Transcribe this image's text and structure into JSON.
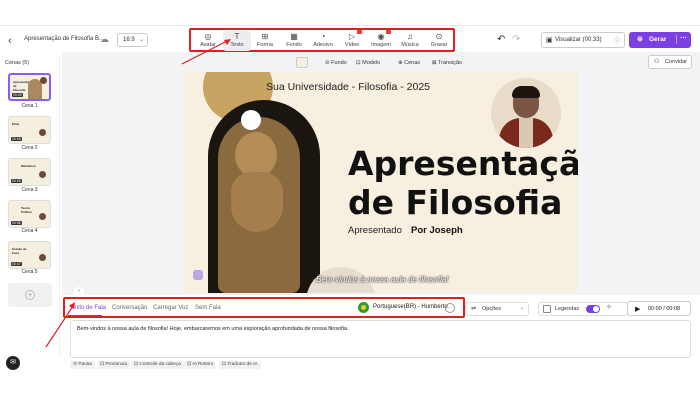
{
  "header": {
    "back_icon": "arrow-left-icon",
    "project_title": "Apresentação de Filosofia B...",
    "cloud_icon": "cloud-icon",
    "aspect_ratio": "16:9",
    "tools": [
      {
        "label": "Avatar",
        "icon": "avatar-icon"
      },
      {
        "label": "Texto",
        "icon": "text-icon",
        "active": true
      },
      {
        "label": "Forma",
        "icon": "shapes-icon"
      },
      {
        "label": "Fundo",
        "icon": "background-icon"
      },
      {
        "label": "Adesivo",
        "icon": "sticker-icon"
      },
      {
        "label": "Vídeo",
        "icon": "video-icon",
        "pro": true
      },
      {
        "label": "Imagem",
        "icon": "image-icon",
        "pro": true
      },
      {
        "label": "Música",
        "icon": "music-icon"
      },
      {
        "label": "Gravar",
        "icon": "record-icon"
      }
    ],
    "preview_label": "Visualizar (00:33)",
    "generate_label": "Gerar",
    "accent": "#7b3fe4"
  },
  "canvas_toolbar": {
    "items": [
      "Fundo",
      "Modelo",
      "Cenas",
      "Transição"
    ]
  },
  "invite_label": "Convidar",
  "scenes": {
    "title": "Cenas (5)",
    "items": [
      {
        "label": "Cena 1",
        "duration": "00:09",
        "thumb_title": "Apresentação de Filosofia"
      },
      {
        "label": "Cena 2",
        "duration": "00:05",
        "thumb_title": "Ética"
      },
      {
        "label": "Cena 3",
        "duration": "00:05",
        "thumb_title": "Metafísica"
      },
      {
        "label": "Cena 4",
        "duration": "00:06",
        "thumb_title": "Teoria Política"
      },
      {
        "label": "Cena 5",
        "duration": "00:07",
        "thumb_title": "Estudo de Caso"
      }
    ]
  },
  "slide": {
    "university": "Sua Universidade - Filosofia - 2025",
    "title_line1": "Apresentação",
    "title_line2": "de Filosofia",
    "presented": "Apresentado",
    "by": "Por Joseph",
    "subtitle": "Bem-vindos à nossa aula de filosofia!"
  },
  "script_panel": {
    "tabs": [
      "Texto de Fala",
      "Conversação",
      "Carregar Voz",
      "Sem Fala"
    ],
    "voice": "Portuguese(BR) - Humberto",
    "options_label": "Opções",
    "captions_label": "Legendas",
    "time": "00:00 / 00:08",
    "text": "Bem-vindos à nossa aula de filosofia! Hoje, embarcaremos em uma exploração aprofundada de nossa filosofia.",
    "buttons": [
      "Pausa",
      "Pronúncia",
      "Controle da cabeça",
      "IA Roteiro",
      "Tradutor de IA"
    ]
  }
}
